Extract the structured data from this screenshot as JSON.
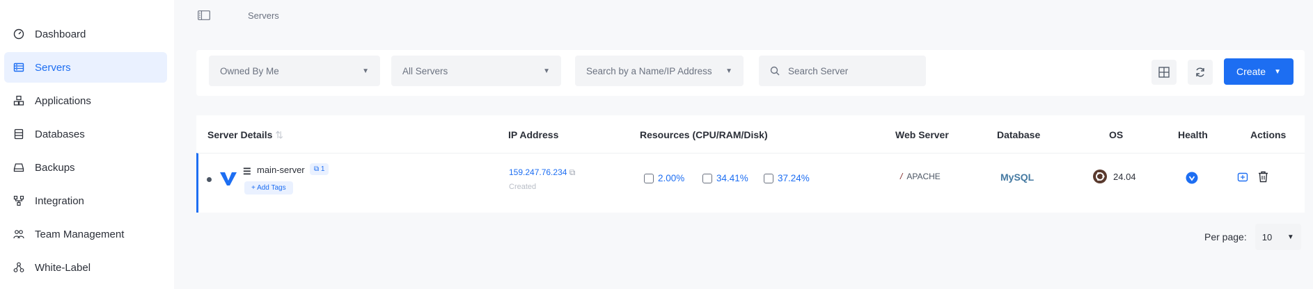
{
  "sidebar": {
    "items": [
      {
        "label": "Dashboard",
        "icon": "speedometer-icon",
        "active": false
      },
      {
        "label": "Servers",
        "icon": "server-icon",
        "active": true
      },
      {
        "label": "Applications",
        "icon": "cubes-icon",
        "active": false
      },
      {
        "label": "Databases",
        "icon": "database-icon",
        "active": false
      },
      {
        "label": "Backups",
        "icon": "hard-drive-icon",
        "active": false
      },
      {
        "label": "Integration",
        "icon": "integration-icon",
        "active": false
      },
      {
        "label": "Team Management",
        "icon": "team-icon",
        "active": false
      },
      {
        "label": "White-Label",
        "icon": "white-label-icon",
        "active": false
      }
    ]
  },
  "breadcrumb": {
    "current": "Servers"
  },
  "filters": {
    "owner": "Owned By Me",
    "servers": "All Servers",
    "search_type": "Search by a Name/IP Address",
    "search_placeholder": "Search Server"
  },
  "toolbar": {
    "create_label": "Create"
  },
  "table": {
    "headers": [
      "Server Details",
      "IP Address",
      "Resources (CPU/RAM/Disk)",
      "Web Server",
      "Database",
      "OS",
      "Health",
      "Actions"
    ],
    "rows": [
      {
        "name": "main-server",
        "badge": "1",
        "add_tags": "+ Add Tags",
        "ip": "159.247.76.234",
        "ip_sub": "Created",
        "cpu": "2.00%",
        "ram": "34.41%",
        "disk": "37.24%",
        "web_server": "APACHE",
        "database": "MySQL",
        "os_version": "24.04"
      }
    ]
  },
  "pagination": {
    "per_page_label": "Per page:",
    "per_page_value": "10"
  },
  "colors": {
    "accent": "#1d6ef2",
    "active_bg": "#eaf1ff"
  }
}
